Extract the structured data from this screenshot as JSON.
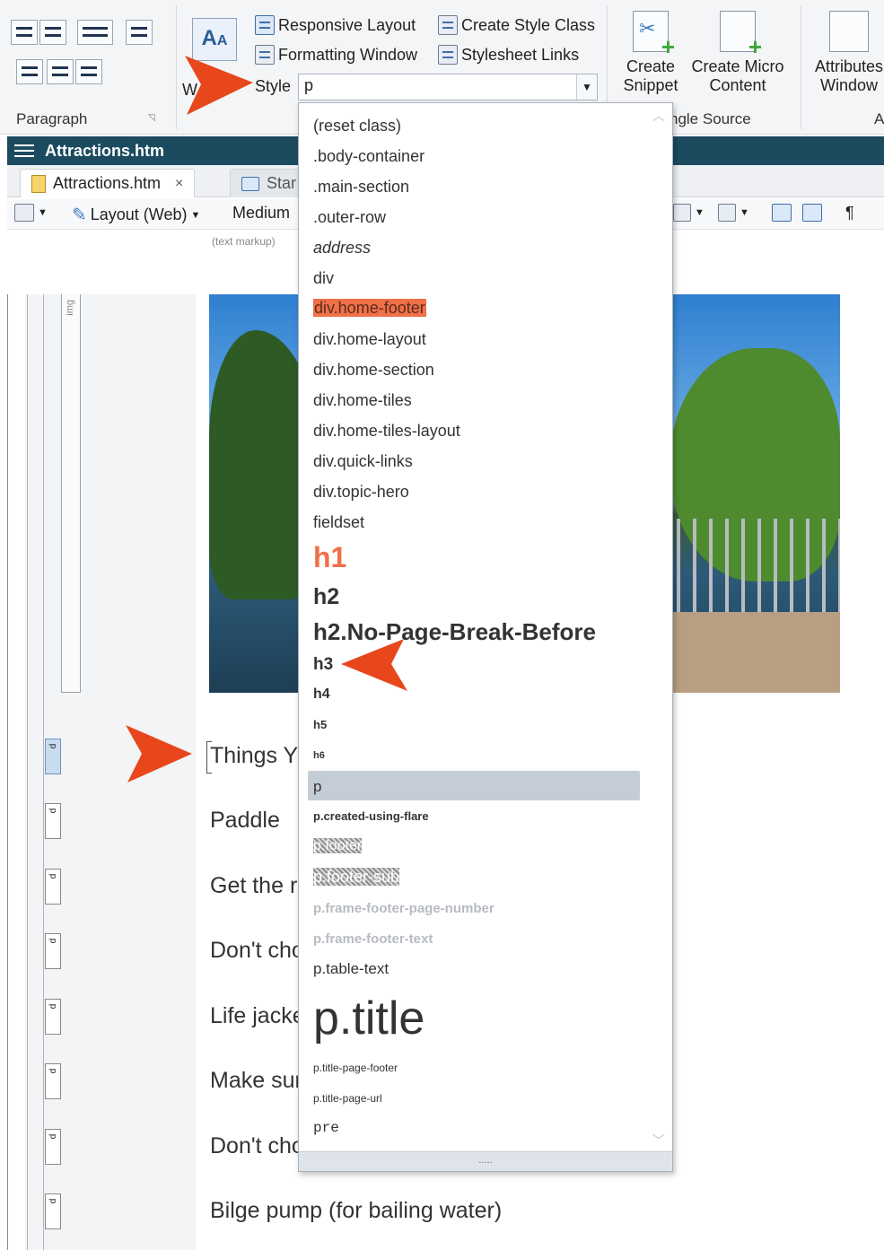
{
  "ribbon": {
    "groups": {
      "paragraph": "Paragraph",
      "single_source": "ngle Source",
      "attributes_fragment": "A"
    },
    "responsive_layout": "Responsive Layout",
    "formatting_window": "Formatting Window",
    "create_style_class": "Create Style Class",
    "stylesheet_links": "Stylesheet Links",
    "style_label": "Style",
    "style_value": "p",
    "partial_label_le": "le",
    "partial_label_w": "W",
    "create_snippet": [
      "Create",
      "Snippet"
    ],
    "create_micro_content": [
      "Create Micro",
      "Content"
    ],
    "attributes_window": [
      "Attributes",
      "Window"
    ]
  },
  "document": {
    "title": "Attractions.htm",
    "tabs": [
      {
        "label": "Attractions.htm",
        "close": "×"
      },
      {
        "label": "Star"
      }
    ],
    "toolbar": {
      "layout": "Layout (Web)",
      "medium": "Medium",
      "markup_note": "(text markup)",
      "pilcrow": "¶"
    },
    "gutter_img_label": "img",
    "gutter_p_label": "p",
    "lines": [
      "Things Y",
      "Paddle",
      "Get the ri",
      "Don't cho",
      "Life jacke",
      "Make sur",
      "Don't cho",
      "Bilge pump (for bailing water)"
    ]
  },
  "style_dropdown": {
    "items": [
      "(reset class)",
      ".body-container",
      ".main-section",
      ".outer-row",
      "address",
      "div",
      "div.home-footer",
      "div.home-layout",
      "div.home-section",
      "div.home-tiles",
      "div.home-tiles-layout",
      "div.quick-links",
      "div.topic-hero",
      "fieldset",
      "h1",
      "h2",
      "h2.No-Page-Break-Before",
      "h3",
      "h4",
      "h5",
      "h6",
      "p",
      "p.created-using-flare",
      "p.footer",
      "p.footer-sub",
      "p.frame-footer-page-number",
      "p.frame-footer-text",
      "p.table-text",
      "p.title",
      "p.title-page-footer",
      "p.title-page-url",
      "pre"
    ],
    "selected": "p",
    "highlighted": "div.home-footer",
    "grip": "....."
  },
  "colors": {
    "accent_orange": "#f07048",
    "arrow_red": "#e8471c",
    "title_bar": "#1c4b60",
    "selected_bg": "#c4ccd6"
  }
}
